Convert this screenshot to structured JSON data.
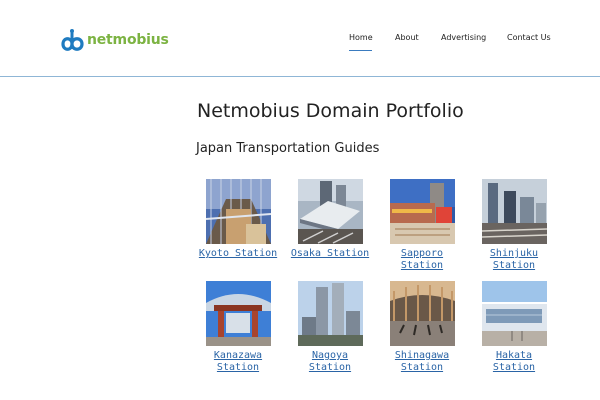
{
  "logo": {
    "text": "netmobius",
    "icon": "infinity-logo-icon",
    "brand_color": "#7cb342",
    "icon_color": "#1f7bc0"
  },
  "nav": {
    "items": [
      {
        "label": "Home",
        "active": true
      },
      {
        "label": "About",
        "active": false
      },
      {
        "label": "Advertising",
        "active": false
      },
      {
        "label": "Contact Us",
        "active": false
      }
    ],
    "accent_color": "#3a7bbf"
  },
  "page_title": "Netmobius Domain Portfolio",
  "section_title": "Japan Transportation Guides",
  "link_color": "#2a64a6",
  "stations": [
    {
      "line1": "Kyoto Station",
      "line2": ""
    },
    {
      "line1": "Osaka Station",
      "line2": ""
    },
    {
      "line1": "Sapporo",
      "line2": "Station"
    },
    {
      "line1": "Shinjuku",
      "line2": "Station"
    },
    {
      "line1": "Kanazawa",
      "line2": "Station"
    },
    {
      "line1": "Nagoya",
      "line2": "Station"
    },
    {
      "line1": "Shinagawa",
      "line2": "Station"
    },
    {
      "line1": "Hakata",
      "line2": "Station"
    }
  ]
}
